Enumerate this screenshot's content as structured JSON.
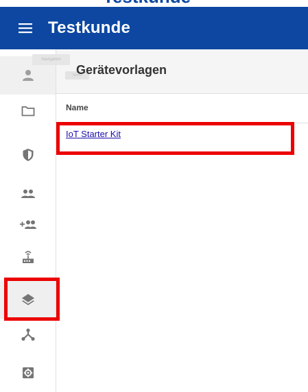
{
  "header": {
    "title": "Testkunde",
    "menu_icon": "hamburger-menu-icon",
    "background_color": "#0d47a1"
  },
  "sidebar": {
    "items": [
      {
        "icon": "user-icon",
        "tooltip": "Navigation"
      },
      {
        "icon": "folder-icon"
      },
      {
        "icon": "shield-icon"
      },
      {
        "icon": "group-icon"
      },
      {
        "icon": "add-group-icon"
      },
      {
        "icon": "router-icon"
      },
      {
        "icon": "layers-icon",
        "selected": true
      },
      {
        "icon": "hierarchy-icon"
      },
      {
        "icon": "settings-box-icon"
      }
    ]
  },
  "main": {
    "page_title": "Gerätevorlagen",
    "header_chip": "Menü",
    "table": {
      "columns": [
        "Name"
      ],
      "rows": [
        {
          "name": "IoT Starter Kit"
        }
      ]
    }
  },
  "colors": {
    "link": "#1a0dab",
    "highlight": "#ec0000",
    "sidebar_selected": "#efefef"
  }
}
